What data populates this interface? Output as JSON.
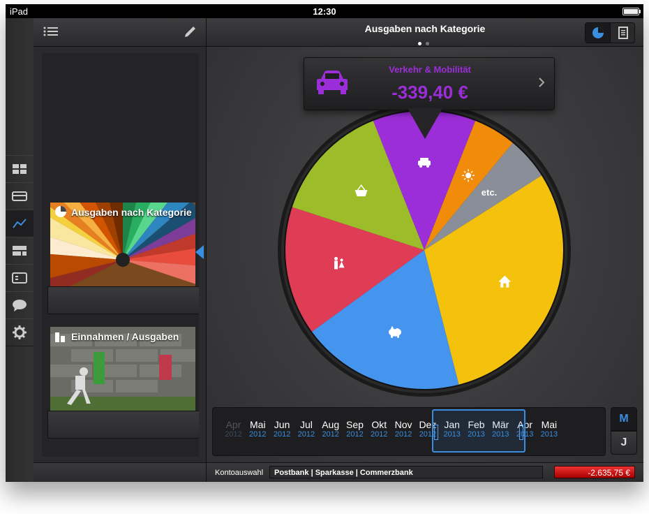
{
  "statusbar": {
    "carrier": "iPad",
    "time": "12:30"
  },
  "colors": {
    "accent": "#3a8ee0",
    "purple": "#9b2ed8",
    "orange": "#f08c0a",
    "gray": "#8a8e99",
    "yellow": "#f4c20d",
    "blue": "#4595ef",
    "red": "#df3c55",
    "green": "#9cbc2a",
    "negative": "#cc1111"
  },
  "sidebar": {
    "menu_icon": "list-icon",
    "edit_icon": "pencil-icon",
    "cards": [
      {
        "title": "Ausgaben nach Kategorie",
        "icon": "pie-chart-icon"
      },
      {
        "title": "Einnahmen / Ausgaben",
        "icon": "bar-chart-icon"
      }
    ],
    "rail_icons": [
      "grid-icon",
      "card-icon",
      "chart-line-icon",
      "layout-icon",
      "list-card-icon",
      "speech-bubble-icon",
      "gear-icon"
    ]
  },
  "main": {
    "title": "Ausgaben nach Kategorie",
    "page_indicator": {
      "count": 2,
      "active": 1
    },
    "view_toggle": [
      "pie-chart-icon",
      "document-icon"
    ],
    "popover": {
      "category": "Verkehr & Mobilität",
      "amount": "-339,40 €",
      "icon": "car-icon"
    },
    "pie_labels": {
      "etc": "etc."
    }
  },
  "chart_data": {
    "type": "pie",
    "slices": [
      {
        "category": "Verkehr & Mobilität",
        "value": 12,
        "color": "#9b2ed8",
        "icon": "car-icon"
      },
      {
        "icon": "sun-icon",
        "value": 5,
        "color": "#f08c0a"
      },
      {
        "label": "etc.",
        "value": 5,
        "color": "#8a8e99"
      },
      {
        "icon": "house-icon",
        "value": 30,
        "color": "#f4c20d"
      },
      {
        "icon": "piggy-bank-icon",
        "value": 19,
        "color": "#4595ef"
      },
      {
        "icon": "family-icon",
        "value": 15,
        "color": "#df3c55"
      },
      {
        "icon": "basket-icon",
        "value": 14,
        "color": "#9cbc2a"
      }
    ]
  },
  "timeline": {
    "months": [
      {
        "m": "Apr",
        "y": "2012",
        "state": "faded"
      },
      {
        "m": "Mai",
        "y": "2012",
        "state": "normal"
      },
      {
        "m": "Jun",
        "y": "2012",
        "state": "normal"
      },
      {
        "m": "Jul",
        "y": "2012",
        "state": "normal"
      },
      {
        "m": "Aug",
        "y": "2012",
        "state": "normal"
      },
      {
        "m": "Sep",
        "y": "2012",
        "state": "normal"
      },
      {
        "m": "Okt",
        "y": "2012",
        "state": "normal"
      },
      {
        "m": "Nov",
        "y": "2012",
        "state": "normal"
      },
      {
        "m": "Dez",
        "y": "2012",
        "state": "normal"
      },
      {
        "m": "Jan",
        "y": "2013",
        "state": "selected"
      },
      {
        "m": "Feb",
        "y": "2013",
        "state": "selected"
      },
      {
        "m": "Mär",
        "y": "2013",
        "state": "selected"
      },
      {
        "m": "Apr",
        "y": "2013",
        "state": "normal"
      },
      {
        "m": "Mai",
        "y": "2013",
        "state": "normal"
      }
    ],
    "mode_buttons": {
      "month": "M",
      "year": "J"
    }
  },
  "footer": {
    "account_label": "Kontoauswahl",
    "accounts": "Postbank | Sparkasse | Commerzbank",
    "balance": "-2.635,75 €"
  }
}
